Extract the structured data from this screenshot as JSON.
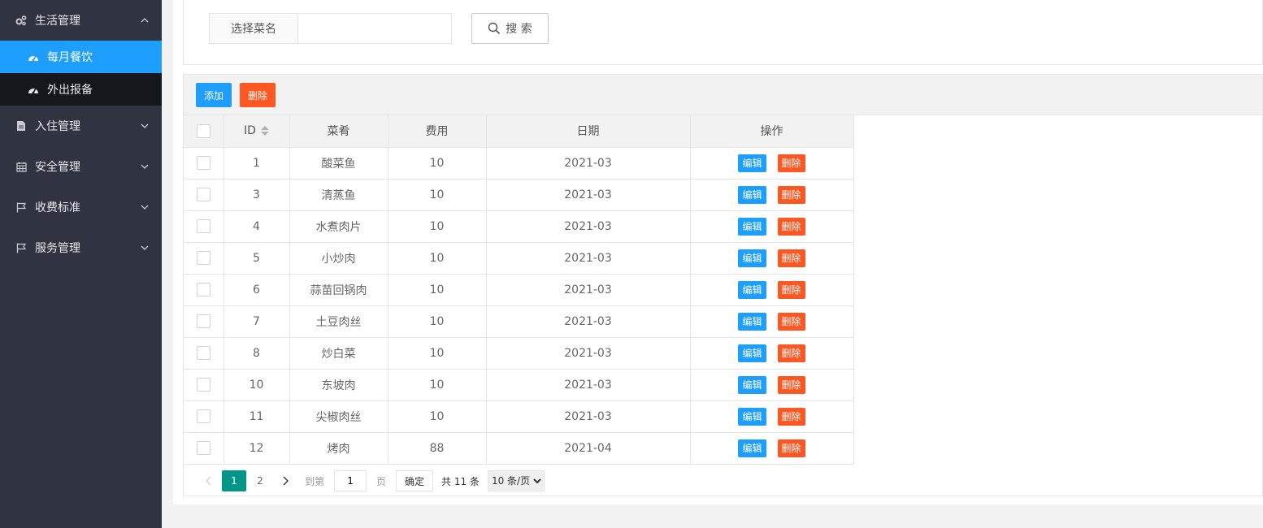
{
  "sidebar": {
    "items": [
      {
        "label": "生活管理",
        "icon": "gears-icon",
        "expanded": true,
        "children": [
          {
            "label": "每月餐饮",
            "icon": "dashboard-icon",
            "active": true
          },
          {
            "label": "外出报备",
            "icon": "dashboard-icon",
            "active": false
          }
        ]
      },
      {
        "label": "入住管理",
        "icon": "file-icon",
        "expanded": false
      },
      {
        "label": "安全管理",
        "icon": "calendar-icon",
        "expanded": false
      },
      {
        "label": "收费标准",
        "icon": "flag-icon",
        "expanded": false
      },
      {
        "label": "服务管理",
        "icon": "flag-icon",
        "expanded": false
      }
    ]
  },
  "search": {
    "label": "选择菜名",
    "value": "",
    "placeholder": "",
    "button_label": "搜 索"
  },
  "toolbar": {
    "add_label": "添加",
    "delete_label": "删除"
  },
  "table": {
    "columns": [
      "ID",
      "菜肴",
      "费用",
      "日期",
      "操作"
    ],
    "rows": [
      {
        "id": "1",
        "dish": "酸菜鱼",
        "cost": "10",
        "date": "2021-03"
      },
      {
        "id": "3",
        "dish": "清蒸鱼",
        "cost": "10",
        "date": "2021-03"
      },
      {
        "id": "4",
        "dish": "水煮肉片",
        "cost": "10",
        "date": "2021-03"
      },
      {
        "id": "5",
        "dish": "小炒肉",
        "cost": "10",
        "date": "2021-03"
      },
      {
        "id": "6",
        "dish": "蒜苗回锅肉",
        "cost": "10",
        "date": "2021-03"
      },
      {
        "id": "7",
        "dish": "土豆肉丝",
        "cost": "10",
        "date": "2021-03"
      },
      {
        "id": "8",
        "dish": "炒白菜",
        "cost": "10",
        "date": "2021-03"
      },
      {
        "id": "10",
        "dish": "东坡肉",
        "cost": "10",
        "date": "2021-03"
      },
      {
        "id": "11",
        "dish": "尖椒肉丝",
        "cost": "10",
        "date": "2021-03"
      },
      {
        "id": "12",
        "dish": "烤肉",
        "cost": "88",
        "date": "2021-04"
      }
    ],
    "row_actions": {
      "edit": "编辑",
      "delete": "删除"
    }
  },
  "pager": {
    "pages": [
      "1",
      "2"
    ],
    "current": "1",
    "goto_prefix": "到第",
    "goto_value": "1",
    "goto_suffix": "页",
    "confirm": "确定",
    "total": "共 11 条",
    "page_size": "10 条/页"
  },
  "colors": {
    "sidebar_bg": "#2f3440",
    "active_blue": "#1e9fff",
    "danger": "#ff5722",
    "page_current": "#009688"
  }
}
